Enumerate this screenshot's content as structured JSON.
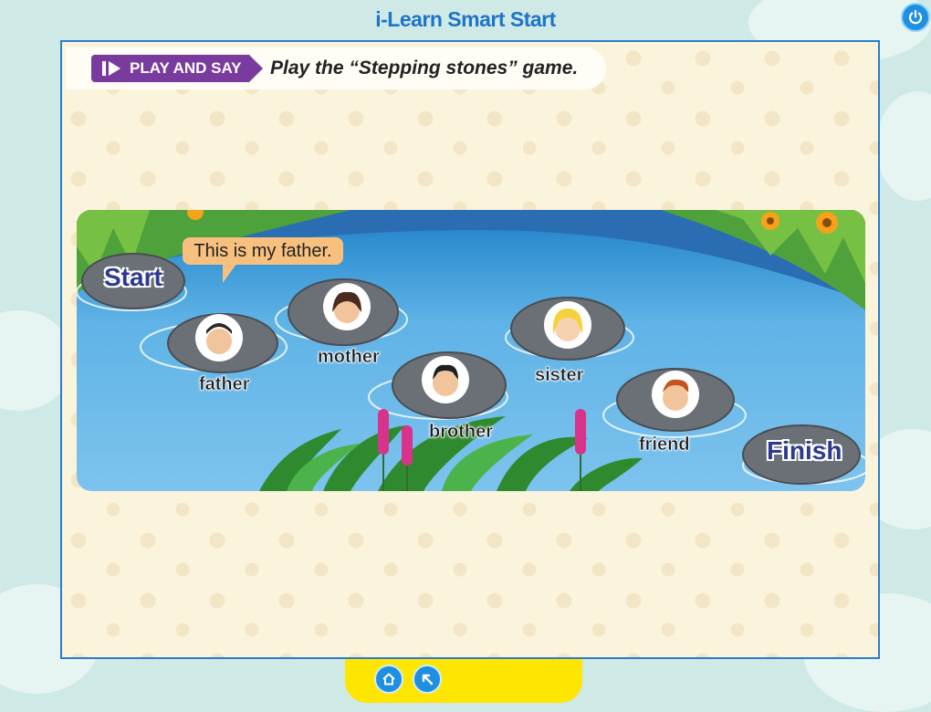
{
  "app": {
    "title": "i-Learn Smart Start"
  },
  "icons": {
    "power": "power-icon",
    "home": "home-icon",
    "back": "back-arrow-icon",
    "play": "play-icon"
  },
  "instruction": {
    "tag": "PLAY AND SAY",
    "text": "Play the “Stepping stones” game."
  },
  "game": {
    "speech": "This is my father.",
    "start": "Start",
    "finish": "Finish",
    "stones": [
      "father",
      "mother",
      "brother",
      "sister",
      "friend"
    ]
  },
  "colors": {
    "accent": "#1d74c8",
    "tag": "#7a3b9e",
    "bottom_bar": "#ffe600",
    "water": "#5fb3e6"
  }
}
